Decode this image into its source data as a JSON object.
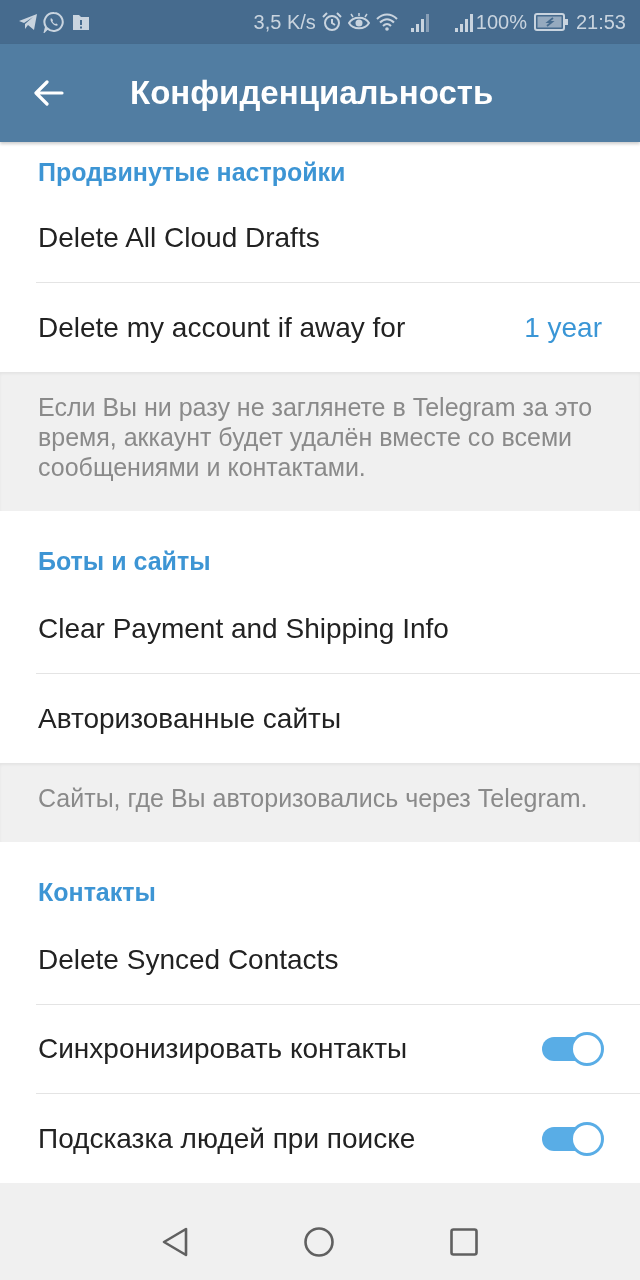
{
  "status_bar": {
    "speed": "3,5 K/s",
    "battery": "100%",
    "time": "21:53"
  },
  "header": {
    "title": "Конфиденциальность"
  },
  "sections": [
    {
      "title": "Продвинутые настройки",
      "rows": [
        {
          "kind": "plain",
          "label": "Delete All Cloud Drafts"
        },
        {
          "kind": "value",
          "label": "Delete my account if away for",
          "value": "1 year"
        }
      ],
      "footer": "Если Вы ни разу не заглянете в Telegram за это время, аккаунт будет удалён вместе со всеми сообщениями и контактами."
    },
    {
      "title": "Боты и сайты",
      "rows": [
        {
          "kind": "plain",
          "label": "Clear Payment and Shipping Info"
        },
        {
          "kind": "plain",
          "label": "Авторизованные сайты"
        }
      ],
      "footer": "Сайты, где Вы авторизовались через Telegram."
    },
    {
      "title": "Контакты",
      "rows": [
        {
          "kind": "plain",
          "label": "Delete Synced Contacts"
        },
        {
          "kind": "toggle",
          "label": "Синхронизировать контакты",
          "on": true
        },
        {
          "kind": "toggle",
          "label": "Подсказка людей при поиске",
          "on": true
        }
      ]
    }
  ]
}
